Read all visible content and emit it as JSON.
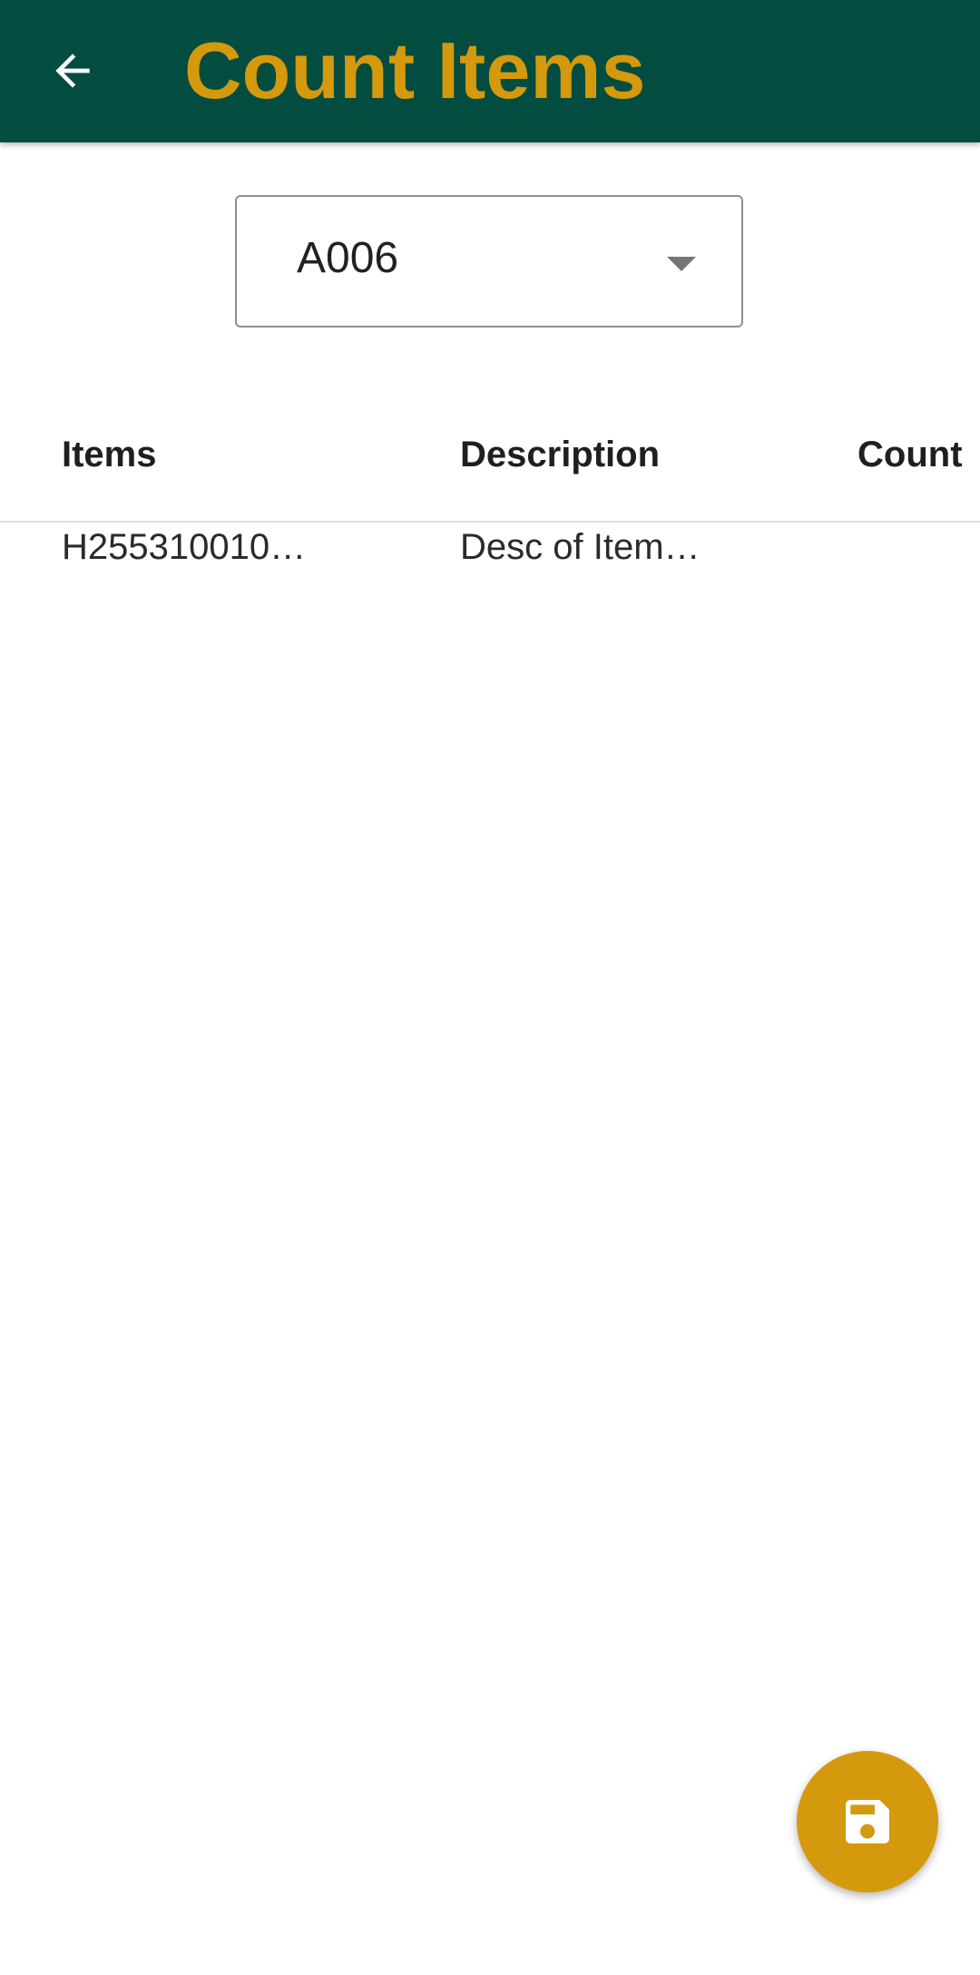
{
  "header": {
    "title": "Count Items",
    "back_icon": "arrow-back-icon"
  },
  "location_select": {
    "selected_value": "A006",
    "icon": "dropdown-arrow-icon"
  },
  "table": {
    "columns": [
      "Items",
      "Description",
      "Count"
    ],
    "rows": [
      {
        "item": "H255310010…",
        "description": "Desc of Item…",
        "count": ""
      }
    ]
  },
  "fab": {
    "icon": "save-icon"
  },
  "colors": {
    "appbar": "#024d40",
    "accent": "#d4990c"
  }
}
